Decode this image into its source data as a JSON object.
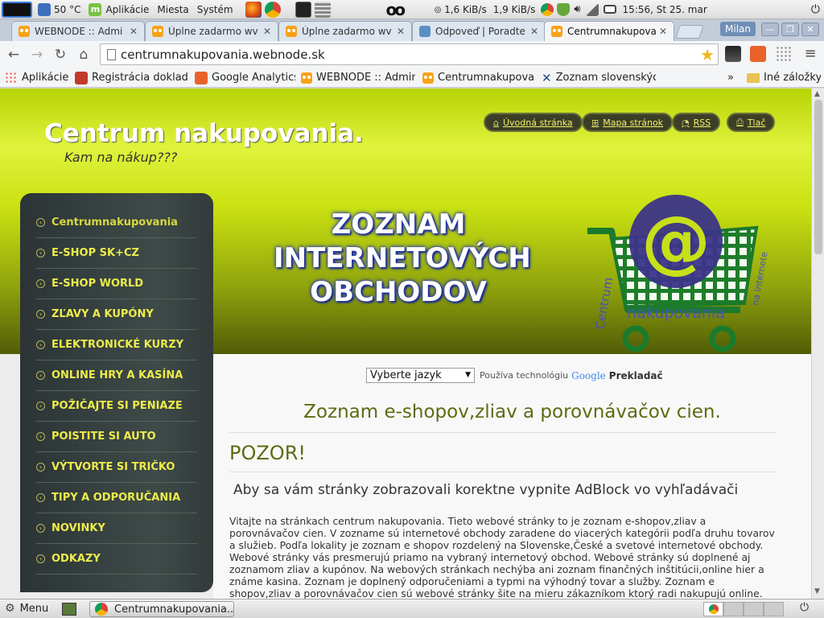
{
  "os_panel": {
    "temperature": "50 °C",
    "menu_applications": "Aplikácie",
    "menu_places": "Miesta",
    "menu_system": "Systém",
    "net_down": "1,6 KiB/s",
    "net_up": "1,9 KiB/s",
    "clock": "15:56, St 25. mar"
  },
  "tabs": [
    {
      "label": "WEBNODE :: Admi"
    },
    {
      "label": "Úplne zadarmo wv"
    },
    {
      "label": "Úplne zadarmo wv"
    },
    {
      "label": "Odpoveď | Poradte"
    },
    {
      "label": "Centrumnakupova"
    }
  ],
  "window": {
    "profile": "Milan"
  },
  "address_bar": {
    "url": "centrumnakupovania.webnode.sk"
  },
  "bookmarks": [
    {
      "label": "Aplikácie"
    },
    {
      "label": "Registrácia dokladu"
    },
    {
      "label": "Google Analytics"
    },
    {
      "label": "WEBNODE :: Admin"
    },
    {
      "label": "Centrumnakupovar"
    },
    {
      "label": "Zoznam slovenskýc"
    }
  ],
  "bookmarks_more": "»",
  "bookmarks_other": "Iné záložky",
  "site": {
    "title": "Centrum nakupovania.",
    "subtitle": "Kam na nákup???",
    "top_links": [
      "Úvodná stránka",
      "Mapa stránok",
      "RSS",
      "Tlač"
    ],
    "banner_lines": [
      "ZOZNAM",
      "INTERNETOVÝCH",
      "OBCHODOV"
    ],
    "cart_logo_text": [
      "Centrum",
      "nakupovania",
      "na internete"
    ]
  },
  "sidebar_menu": [
    "Centrumnakupovania",
    "E-SHOP SK+CZ",
    "E-SHOP WORLD",
    "ZĽAVY A KUPÓNY",
    "ELEKTRONICKÉ KURZY",
    "ONLINE HRY A KASÍNA",
    "POŽIČAJTE SI PENIAZE",
    "POISTITE SI AUTO",
    "VÝTVORTE SI TRIČKO",
    "TIPY A ODPORUČANIA",
    "NOVINKY",
    "ODKAZY"
  ],
  "translate": {
    "select_value": "Vyberte jazyk",
    "powered_by": "Používa technológiu",
    "google": "Google",
    "translate_link": "Prekladač"
  },
  "content": {
    "heading": "Zoznam e-shopov,zliav a porovnávačov cien.",
    "warning": "POZOR!",
    "adblock_note": "Aby sa vám stránky zobrazovali korektne vypnite AdBlock vo vyhľadávači",
    "body": "Vitajte na stránkach centrum nakupovania. Tieto webové stránky to je zoznam e-shopov,zliav a porovnávačov cien. V zozname sú internetové obchody zaradene do viacerých kategórii podľa druhu tovarov a služieb. Podľa lokality je zoznam e shopov rozdelený na Slovenske,České a svetové internetové obchody.  Webové stránky vás presmerujú priamo na vybraný internetový obchod. Webové stránky sú doplnené aj zoznamom zliav a  kupónov. Na webových stránkach nechýba ani zoznam finančných inštitúcii,online hier a známe kasina. Zoznam je doplnený odporučeniami a typmi na výhodný tovar a služby. Zoznam e shopov,zliav a porovnávačov cien sú webové stránky šite na mieru zákazníkom ktorý radi nakupujú online. Už nemusíte dlhé hodiny tráviť vyhľadávaním internetových obchodov, lebo"
  },
  "taskbar": {
    "menu_label": "Menu",
    "window_label": "Centrumnakupovania..."
  },
  "colors": {
    "header_lime": "#c9e111",
    "sidebar_dark": "#333a3a",
    "menu_text": "#ecec4a",
    "heading_olive": "#5a6d12",
    "tab_bar": "#c3ccd9"
  }
}
